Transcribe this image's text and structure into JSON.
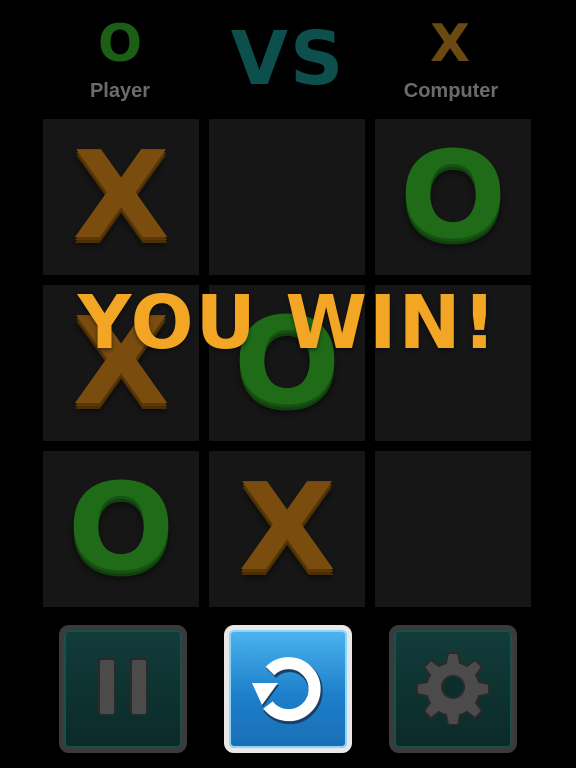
{
  "header": {
    "player_symbol": "O",
    "player_label": "Player",
    "vs_label": "VS",
    "computer_symbol": "X",
    "computer_label": "Computer",
    "colors": {
      "o": "#1d5e15",
      "x": "#6a4a12",
      "vs": "#0d4f4c"
    }
  },
  "board": {
    "cells": [
      "X",
      "",
      "O",
      "X",
      "O",
      "",
      "O",
      "X",
      ""
    ]
  },
  "result": {
    "banner": "YOU WIN!"
  },
  "controls": {
    "pause_icon": "pause-icon",
    "restart_icon": "restart-arrow-icon",
    "settings_icon": "gear-icon"
  }
}
